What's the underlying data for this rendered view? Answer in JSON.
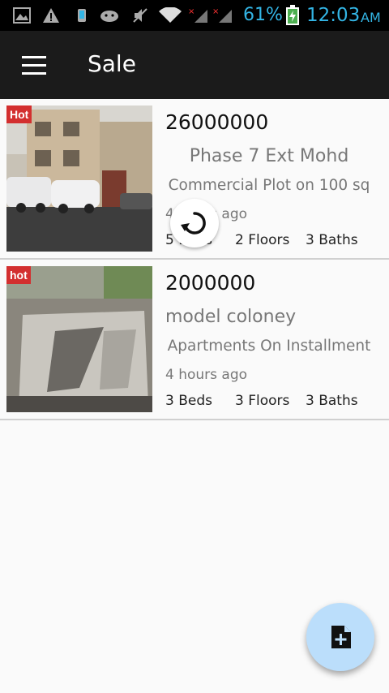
{
  "status_bar": {
    "battery_percent": "61%",
    "time": "12:03",
    "ampm": "AM"
  },
  "app_bar": {
    "title": "Sale",
    "menu_icon": "hamburger-menu-icon"
  },
  "listings": [
    {
      "badge": "Hot",
      "price": "26000000",
      "location": "Phase 7 Ext Mohd",
      "property_type": "Commercial Plot on 100 sq",
      "time_ago": "4 hours ago",
      "beds": "5 Beds",
      "floors": "2 Floors",
      "baths": "3 Baths"
    },
    {
      "badge": "hot",
      "price": "2000000",
      "location": "model coloney",
      "property_type": "Apartments On Installment",
      "time_ago": "4 hours ago",
      "beds": "3 Beds",
      "floors": "3 Floors",
      "baths": "3 Baths"
    }
  ],
  "fab": {
    "icon": "add-document-icon"
  },
  "colors": {
    "status_accent": "#33b5e5",
    "app_bar": "#1b1b1b",
    "hot_badge": "#d32f2f",
    "fab": "#bbdefb"
  }
}
